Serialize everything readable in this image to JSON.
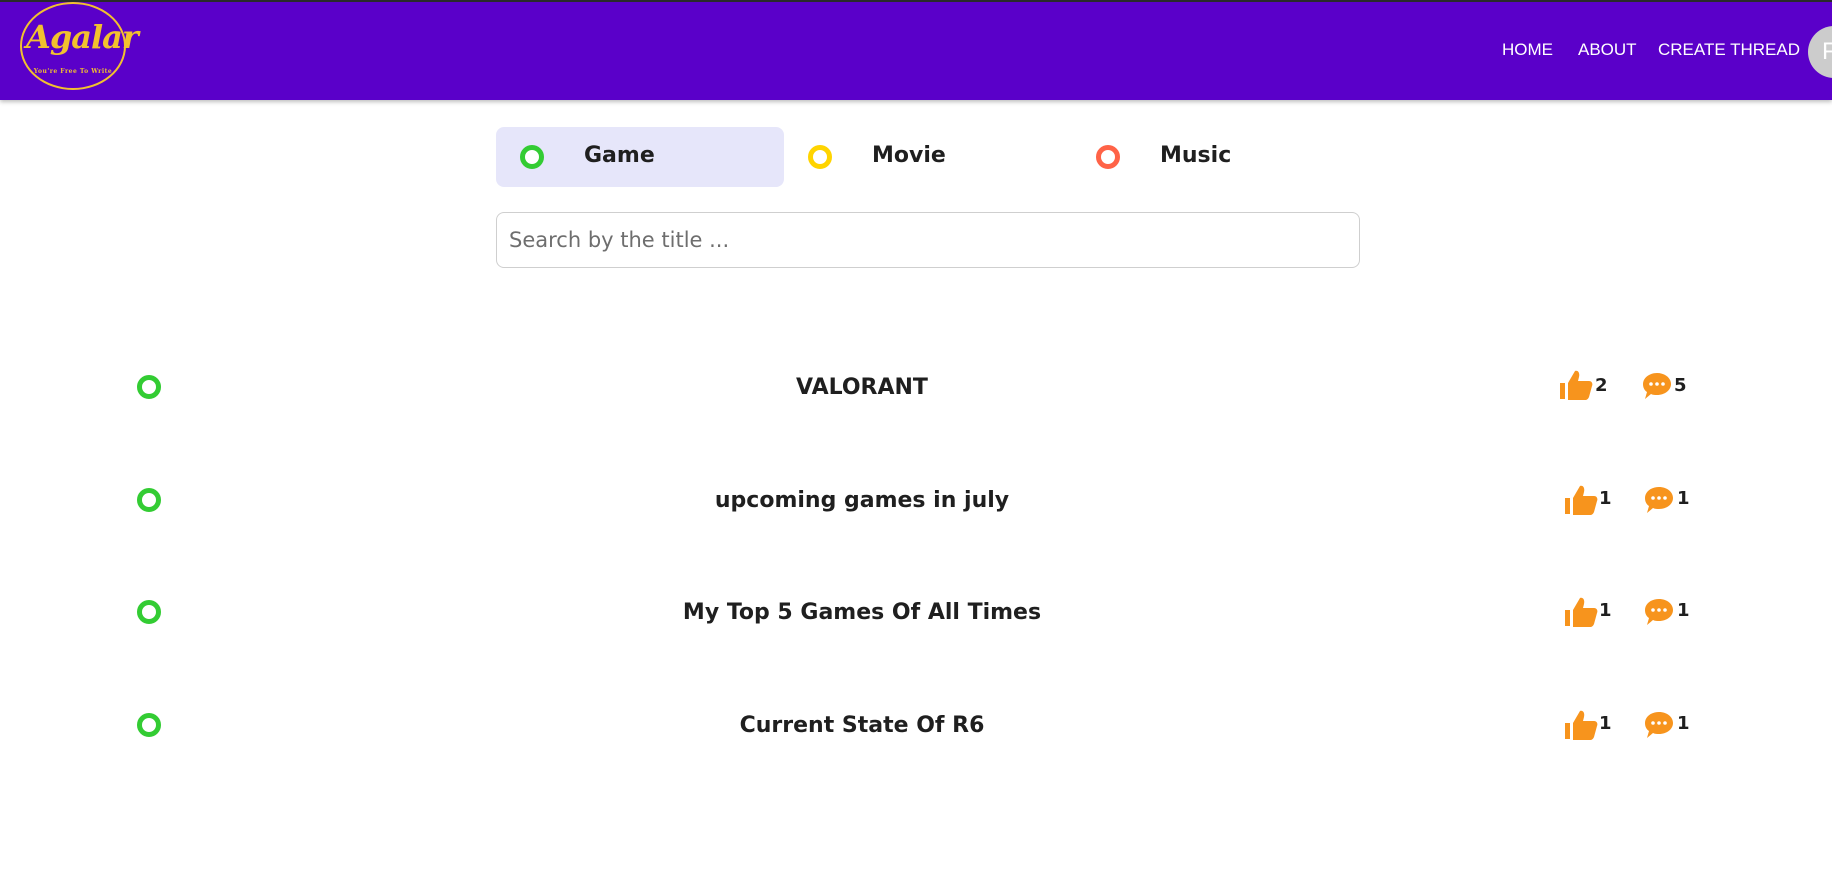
{
  "header": {
    "logo_text": "Agalar",
    "logo_tagline": "You're Free To Write",
    "nav": [
      {
        "label": "HOME"
      },
      {
        "label": "ABOUT"
      },
      {
        "label": "CREATE THREAD"
      }
    ],
    "avatar_letter": "F"
  },
  "categories": [
    {
      "label": "Game",
      "color": "#33cc33",
      "selected": true
    },
    {
      "label": "Movie",
      "color": "#ffd400",
      "selected": false
    },
    {
      "label": "Music",
      "color": "#ff6347",
      "selected": false
    }
  ],
  "search": {
    "placeholder": "Search by the title ...",
    "value": ""
  },
  "threads": [
    {
      "title": "VALORANT",
      "likes": "2",
      "comments": "5",
      "category_color": "#33cc33"
    },
    {
      "title": "upcoming games in july",
      "likes": "1",
      "comments": "1",
      "category_color": "#33cc33"
    },
    {
      "title": "My Top 5 Games Of All Times",
      "likes": "1",
      "comments": "1",
      "category_color": "#33cc33"
    },
    {
      "title": "Current State Of R6",
      "likes": "1",
      "comments": "1",
      "category_color": "#33cc33"
    }
  ],
  "icons": {
    "like": "thumbs-up-icon",
    "comment": "speech-bubble-icon",
    "accent_color": "#f7941d"
  },
  "colors": {
    "header_bg": "#5a00c9",
    "logo": "#f2c12e"
  }
}
